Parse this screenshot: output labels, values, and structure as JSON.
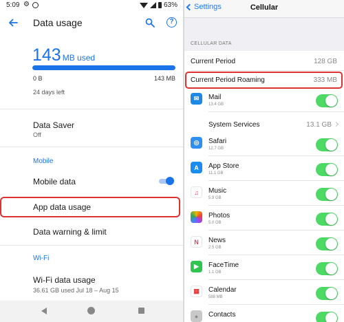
{
  "android": {
    "status_time": "5:09",
    "battery": "63%",
    "title": "Data usage",
    "usage_value": "143",
    "usage_unit": "MB used",
    "usage_fraction": 1.0,
    "bar_min": "0 B",
    "bar_max": "143 MB",
    "days_left": "24 days left",
    "data_saver": {
      "label": "Data Saver",
      "status": "Off"
    },
    "section_mobile": "Mobile",
    "mobile_data": {
      "label": "Mobile data",
      "enabled": true
    },
    "app_data_usage": "App data usage",
    "data_warning": "Data warning & limit",
    "section_wifi": "Wi-Fi",
    "wifi_usage": {
      "label": "Wi-Fi data usage",
      "detail": "36.61 GB used Jul 18 – Aug 15"
    },
    "accent_color": "#1a73e8",
    "highlight_color": "#e03131"
  },
  "ios": {
    "back_label": "Settings",
    "title": "Cellular",
    "section_header": "CELLULAR DATA",
    "current_period": {
      "label": "Current Period",
      "value": "128 GB"
    },
    "roaming": {
      "label": "Current Period Roaming",
      "value": "333 MB"
    },
    "system_services": {
      "label": "System Services",
      "value": "13.1 GB"
    },
    "apps": [
      {
        "name": "Mail",
        "size": "13.4 GB",
        "icon": "mail-icon",
        "enabled": true
      },
      {
        "name": "Safari",
        "size": "12.7 GB",
        "icon": "safari-icon",
        "enabled": true
      },
      {
        "name": "App Store",
        "size": "11.1 GB",
        "icon": "app-store-icon",
        "enabled": true
      },
      {
        "name": "Music",
        "size": "5.9 GB",
        "icon": "music-icon",
        "enabled": true
      },
      {
        "name": "Photos",
        "size": "5.0 GB",
        "icon": "photos-icon",
        "enabled": true
      },
      {
        "name": "News",
        "size": "2.5 GB",
        "icon": "news-icon",
        "enabled": true
      },
      {
        "name": "FaceTime",
        "size": "1.1 GB",
        "icon": "facetime-icon",
        "enabled": true
      },
      {
        "name": "Calendar",
        "size": "588 MB",
        "icon": "calendar-icon",
        "enabled": true
      },
      {
        "name": "Contacts",
        "size": "",
        "icon": "contacts-icon",
        "enabled": true
      }
    ],
    "toggle_color": "#4cd964",
    "link_color": "#1a7af8"
  }
}
